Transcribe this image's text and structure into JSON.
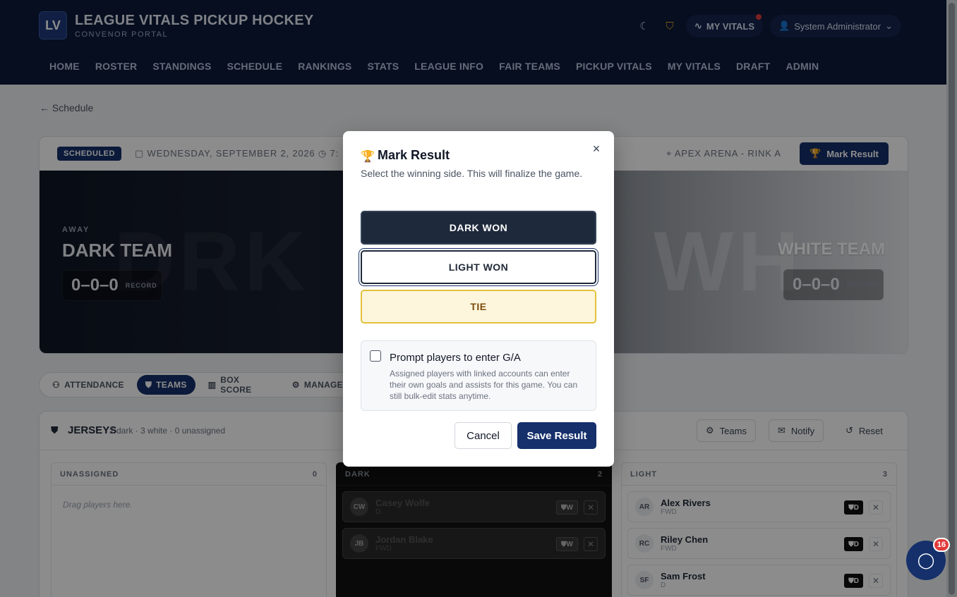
{
  "brand": {
    "logo_text": "LV",
    "title": "LEAGUE VITALS PICKUP HOCKEY",
    "subtitle": "CONVENOR PORTAL"
  },
  "topbar": {
    "my_vitals": "MY VITALS",
    "user": "System Administrator"
  },
  "nav": [
    "HOME",
    "ROSTER",
    "STANDINGS",
    "SCHEDULE",
    "RANKINGS",
    "STATS",
    "LEAGUE INFO",
    "FAIR TEAMS",
    "PICKUP VITALS",
    "MY VITALS",
    "DRAFT",
    "ADMIN"
  ],
  "back": "Schedule",
  "game": {
    "status": "SCHEDULED",
    "date": "WEDNESDAY, SEPTEMBER 2, 2026",
    "time": "7:",
    "venue": "APEX ARENA - RINK A",
    "mark_result": "Mark Result",
    "away_label": "AWAY",
    "away_team": "DARK TEAM",
    "ghost_left": "DRK",
    "ghost_right": "WH",
    "home_team": "WHITE TEAM",
    "away_record": "0–0–0",
    "home_record": "0–0–0",
    "record_label": "RECORD"
  },
  "tabs": [
    "ATTENDANCE",
    "TEAMS",
    "BOX SCORE",
    "MANAGE"
  ],
  "jerseys": {
    "title": "JERSEYS",
    "summary": "2 dark · 3 white · 0 unassigned",
    "btn_teams": "Teams",
    "btn_notify": "Notify",
    "btn_reset": "Reset",
    "unassigned": {
      "label": "UNASSIGNED",
      "count": "0",
      "hint": "Drag players here."
    },
    "dark": {
      "label": "DARK",
      "count": "2",
      "players": [
        {
          "initials": "CW",
          "name": "Casey Wolfe",
          "pos": "D",
          "tag": "W"
        },
        {
          "initials": "JB",
          "name": "Jordan Blake",
          "pos": "FWD",
          "tag": "W"
        }
      ]
    },
    "light": {
      "label": "LIGHT",
      "count": "3",
      "players": [
        {
          "initials": "AR",
          "name": "Alex Rivers",
          "pos": "FWD",
          "tag": "D"
        },
        {
          "initials": "RC",
          "name": "Riley Chen",
          "pos": "FWD",
          "tag": "D"
        },
        {
          "initials": "SF",
          "name": "Sam Frost",
          "pos": "D",
          "tag": "D"
        }
      ]
    }
  },
  "chat": {
    "badge": "16"
  },
  "modal": {
    "title": "Mark Result",
    "description": "Select the winning side. This will finalize the game.",
    "options": {
      "dark": "DARK WON",
      "light": "LIGHT WON",
      "tie": "TIE"
    },
    "prompt_title": "Prompt players to enter G/A",
    "prompt_desc": "Assigned players with linked accounts can enter their own goals and assists for this game. You can still bulk-edit stats anytime.",
    "cancel": "Cancel",
    "save": "Save Result"
  }
}
